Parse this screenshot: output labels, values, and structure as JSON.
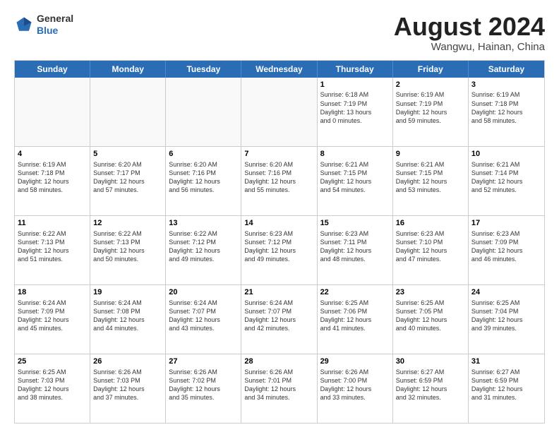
{
  "header": {
    "logo_general": "General",
    "logo_blue": "Blue",
    "month_title": "August 2024",
    "location": "Wangwu, Hainan, China"
  },
  "weekdays": [
    "Sunday",
    "Monday",
    "Tuesday",
    "Wednesday",
    "Thursday",
    "Friday",
    "Saturday"
  ],
  "rows": [
    [
      {
        "day": "",
        "text": "",
        "empty": true
      },
      {
        "day": "",
        "text": "",
        "empty": true
      },
      {
        "day": "",
        "text": "",
        "empty": true
      },
      {
        "day": "",
        "text": "",
        "empty": true
      },
      {
        "day": "1",
        "text": "Sunrise: 6:18 AM\nSunset: 7:19 PM\nDaylight: 13 hours\nand 0 minutes."
      },
      {
        "day": "2",
        "text": "Sunrise: 6:19 AM\nSunset: 7:19 PM\nDaylight: 12 hours\nand 59 minutes."
      },
      {
        "day": "3",
        "text": "Sunrise: 6:19 AM\nSunset: 7:18 PM\nDaylight: 12 hours\nand 58 minutes."
      }
    ],
    [
      {
        "day": "4",
        "text": "Sunrise: 6:19 AM\nSunset: 7:18 PM\nDaylight: 12 hours\nand 58 minutes."
      },
      {
        "day": "5",
        "text": "Sunrise: 6:20 AM\nSunset: 7:17 PM\nDaylight: 12 hours\nand 57 minutes."
      },
      {
        "day": "6",
        "text": "Sunrise: 6:20 AM\nSunset: 7:16 PM\nDaylight: 12 hours\nand 56 minutes."
      },
      {
        "day": "7",
        "text": "Sunrise: 6:20 AM\nSunset: 7:16 PM\nDaylight: 12 hours\nand 55 minutes."
      },
      {
        "day": "8",
        "text": "Sunrise: 6:21 AM\nSunset: 7:15 PM\nDaylight: 12 hours\nand 54 minutes."
      },
      {
        "day": "9",
        "text": "Sunrise: 6:21 AM\nSunset: 7:15 PM\nDaylight: 12 hours\nand 53 minutes."
      },
      {
        "day": "10",
        "text": "Sunrise: 6:21 AM\nSunset: 7:14 PM\nDaylight: 12 hours\nand 52 minutes."
      }
    ],
    [
      {
        "day": "11",
        "text": "Sunrise: 6:22 AM\nSunset: 7:13 PM\nDaylight: 12 hours\nand 51 minutes."
      },
      {
        "day": "12",
        "text": "Sunrise: 6:22 AM\nSunset: 7:13 PM\nDaylight: 12 hours\nand 50 minutes."
      },
      {
        "day": "13",
        "text": "Sunrise: 6:22 AM\nSunset: 7:12 PM\nDaylight: 12 hours\nand 49 minutes."
      },
      {
        "day": "14",
        "text": "Sunrise: 6:23 AM\nSunset: 7:12 PM\nDaylight: 12 hours\nand 49 minutes."
      },
      {
        "day": "15",
        "text": "Sunrise: 6:23 AM\nSunset: 7:11 PM\nDaylight: 12 hours\nand 48 minutes."
      },
      {
        "day": "16",
        "text": "Sunrise: 6:23 AM\nSunset: 7:10 PM\nDaylight: 12 hours\nand 47 minutes."
      },
      {
        "day": "17",
        "text": "Sunrise: 6:23 AM\nSunset: 7:09 PM\nDaylight: 12 hours\nand 46 minutes."
      }
    ],
    [
      {
        "day": "18",
        "text": "Sunrise: 6:24 AM\nSunset: 7:09 PM\nDaylight: 12 hours\nand 45 minutes."
      },
      {
        "day": "19",
        "text": "Sunrise: 6:24 AM\nSunset: 7:08 PM\nDaylight: 12 hours\nand 44 minutes."
      },
      {
        "day": "20",
        "text": "Sunrise: 6:24 AM\nSunset: 7:07 PM\nDaylight: 12 hours\nand 43 minutes."
      },
      {
        "day": "21",
        "text": "Sunrise: 6:24 AM\nSunset: 7:07 PM\nDaylight: 12 hours\nand 42 minutes."
      },
      {
        "day": "22",
        "text": "Sunrise: 6:25 AM\nSunset: 7:06 PM\nDaylight: 12 hours\nand 41 minutes."
      },
      {
        "day": "23",
        "text": "Sunrise: 6:25 AM\nSunset: 7:05 PM\nDaylight: 12 hours\nand 40 minutes."
      },
      {
        "day": "24",
        "text": "Sunrise: 6:25 AM\nSunset: 7:04 PM\nDaylight: 12 hours\nand 39 minutes."
      }
    ],
    [
      {
        "day": "25",
        "text": "Sunrise: 6:25 AM\nSunset: 7:03 PM\nDaylight: 12 hours\nand 38 minutes."
      },
      {
        "day": "26",
        "text": "Sunrise: 6:26 AM\nSunset: 7:03 PM\nDaylight: 12 hours\nand 37 minutes."
      },
      {
        "day": "27",
        "text": "Sunrise: 6:26 AM\nSunset: 7:02 PM\nDaylight: 12 hours\nand 35 minutes."
      },
      {
        "day": "28",
        "text": "Sunrise: 6:26 AM\nSunset: 7:01 PM\nDaylight: 12 hours\nand 34 minutes."
      },
      {
        "day": "29",
        "text": "Sunrise: 6:26 AM\nSunset: 7:00 PM\nDaylight: 12 hours\nand 33 minutes."
      },
      {
        "day": "30",
        "text": "Sunrise: 6:27 AM\nSunset: 6:59 PM\nDaylight: 12 hours\nand 32 minutes."
      },
      {
        "day": "31",
        "text": "Sunrise: 6:27 AM\nSunset: 6:59 PM\nDaylight: 12 hours\nand 31 minutes."
      }
    ]
  ]
}
